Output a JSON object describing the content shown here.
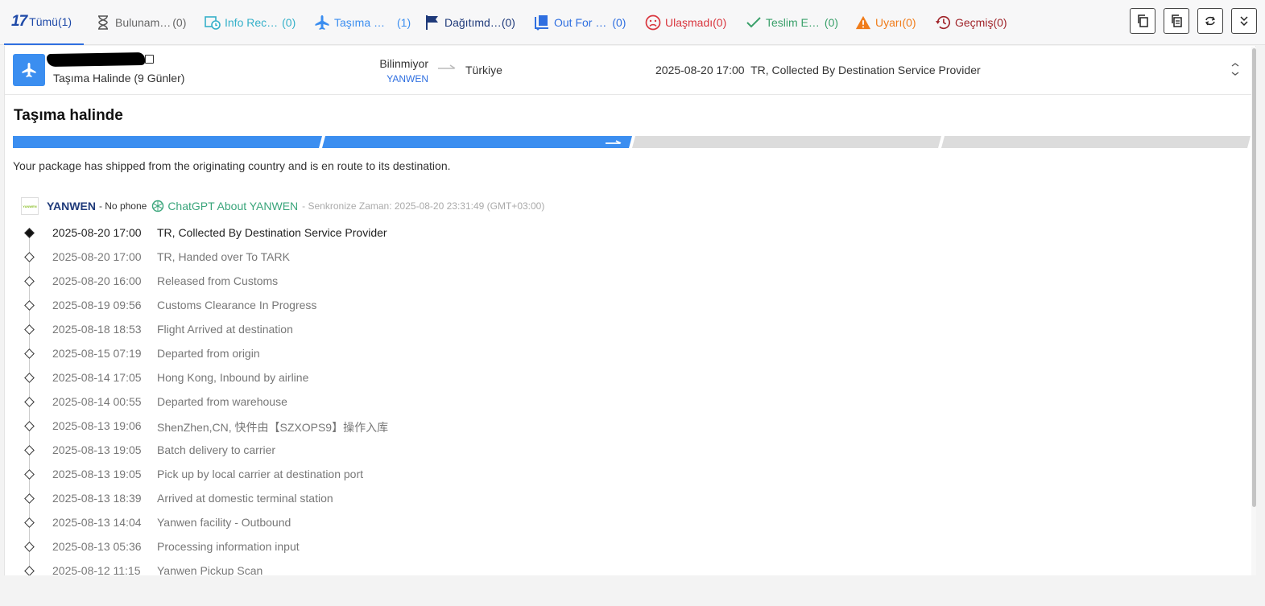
{
  "tabs": [
    {
      "label": "Tümü",
      "count": "(1)",
      "icon": "17-logo",
      "color": "#1f4aa8"
    },
    {
      "label": "Bulunam…",
      "count": "(0)",
      "icon": "hourglass-icon",
      "color": "#666666"
    },
    {
      "label": "Info Rec…",
      "count": "(0)",
      "icon": "clock-calendar-icon",
      "color": "#35b0c9"
    },
    {
      "label": "Taşıma …",
      "count": "(1)",
      "icon": "plane-icon",
      "color": "#3b8ef0"
    },
    {
      "label": "Dağıtımd…",
      "count": "(0)",
      "icon": "flag-icon",
      "color": "#1f3a7a"
    },
    {
      "label": "Out For …",
      "count": "(0)",
      "icon": "delivery-icon",
      "color": "#2f6fe0"
    },
    {
      "label": "Ulaşmadı",
      "count": "(0)",
      "icon": "sad-face-icon",
      "color": "#d9363e"
    },
    {
      "label": "Teslim E…",
      "count": "(0)",
      "icon": "check-icon",
      "color": "#3aa06a"
    },
    {
      "label": "Uyarı",
      "count": "(0)",
      "icon": "warning-icon",
      "color": "#f07c1a"
    },
    {
      "label": "Geçmiş",
      "count": "(0)",
      "icon": "history-icon",
      "color": "#a0242a"
    }
  ],
  "toolbar": [
    "copy-icon",
    "copy-list-icon",
    "refresh-icon",
    "collapse-all-icon"
  ],
  "summary": {
    "status_days": "Taşıma Halinde (9 Günler)",
    "origin": "Bilinmiyor",
    "origin_carrier": "YANWEN",
    "destination": "Türkiye",
    "latest_time": "2025-08-20 17:00",
    "latest_event": "TR, Collected By Destination Service Provider"
  },
  "detail": {
    "title": "Taşıma halinde",
    "progress_stage": 2,
    "progress_total": 4,
    "description": "Your package has shipped from the originating country and is en route to its destination.",
    "carrier_name": "YANWEN",
    "carrier_logo_text": "YANWEN",
    "phone": "- No phone",
    "chatgpt_link": "ChatGPT About YANWEN",
    "sync": "- Senkronize Zaman: 2025-08-20 23:31:49 (GMT+03:00)"
  },
  "events": [
    {
      "time": "2025-08-20 17:00",
      "text": "TR, Collected By Destination Service Provider"
    },
    {
      "time": "2025-08-20 17:00",
      "text": "TR, Handed over To TARK"
    },
    {
      "time": "2025-08-20 16:00",
      "text": "Released from Customs"
    },
    {
      "time": "2025-08-19 09:56",
      "text": "Customs Clearance In Progress"
    },
    {
      "time": "2025-08-18 18:53",
      "text": "Flight Arrived at destination"
    },
    {
      "time": "2025-08-15 07:19",
      "text": "Departed from origin"
    },
    {
      "time": "2025-08-14 17:05",
      "text": "Hong Kong, Inbound by airline"
    },
    {
      "time": "2025-08-14 00:55",
      "text": "Departed from warehouse"
    },
    {
      "time": "2025-08-13 19:06",
      "text": "ShenZhen,CN, 快件由【SZXOPS9】操作入库"
    },
    {
      "time": "2025-08-13 19:05",
      "text": "Batch delivery to carrier"
    },
    {
      "time": "2025-08-13 19:05",
      "text": "Pick up by local carrier at destination port"
    },
    {
      "time": "2025-08-13 18:39",
      "text": "Arrived at domestic terminal station"
    },
    {
      "time": "2025-08-13 14:04",
      "text": "Yanwen facility - Outbound"
    },
    {
      "time": "2025-08-13 05:36",
      "text": "Processing information input"
    },
    {
      "time": "2025-08-12 11:15",
      "text": "Yanwen Pickup Scan"
    }
  ]
}
